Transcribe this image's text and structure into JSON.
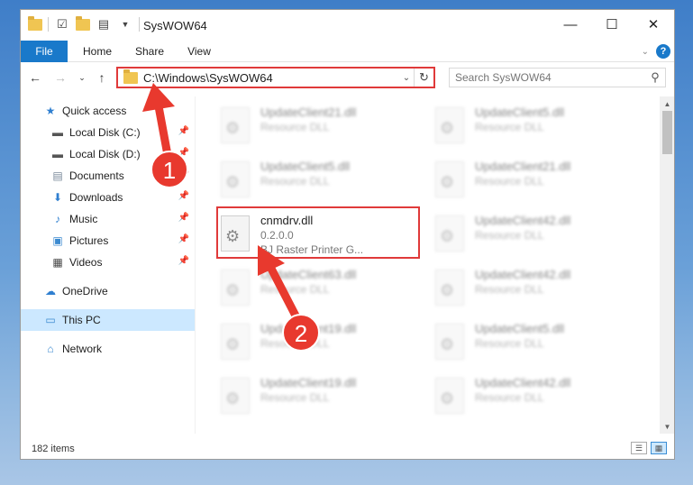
{
  "window": {
    "title": "SysWOW64",
    "min_glyph": "—",
    "max_glyph": "☐",
    "close_glyph": "✕"
  },
  "ribbon": {
    "tabs": [
      "File",
      "Home",
      "Share",
      "View"
    ]
  },
  "address": {
    "path": "C:\\Windows\\SysWOW64",
    "search_placeholder": "Search SysWOW64"
  },
  "sidebar": {
    "items": [
      {
        "label": "Quick access",
        "icon": "star-icon",
        "pinned": false
      },
      {
        "label": "Local Disk (C:)",
        "icon": "drive-icon",
        "pinned": true
      },
      {
        "label": "Local Disk (D:)",
        "icon": "drive-icon",
        "pinned": true
      },
      {
        "label": "Documents",
        "icon": "documents-icon",
        "pinned": true
      },
      {
        "label": "Downloads",
        "icon": "download-icon",
        "pinned": true
      },
      {
        "label": "Music",
        "icon": "music-icon",
        "pinned": true
      },
      {
        "label": "Pictures",
        "icon": "pictures-icon",
        "pinned": true
      },
      {
        "label": "Videos",
        "icon": "videos-icon",
        "pinned": true
      },
      {
        "label": "OneDrive",
        "icon": "cloud-icon",
        "pinned": false
      },
      {
        "label": "This PC",
        "icon": "computer-icon",
        "pinned": false,
        "selected": true
      },
      {
        "label": "Network",
        "icon": "network-icon",
        "pinned": false
      }
    ]
  },
  "files": [
    {
      "name": "UpdateClient21.dll",
      "sub": "Resource DLL",
      "blurred": true
    },
    {
      "name": "UpdateClient5.dll",
      "sub": "Resource DLL",
      "blurred": true
    },
    {
      "name": "UpdateClient5.dll",
      "sub": "Resource DLL",
      "blurred": true
    },
    {
      "name": "UpdateClient21.dll",
      "sub": "Resource DLL",
      "blurred": true
    },
    {
      "name": "cnmdrv.dll",
      "sub": "0.2.0.0",
      "sub2": "BJ Raster Printer G...",
      "blurred": false
    },
    {
      "name": "UpdateClient42.dll",
      "sub": "Resource DLL",
      "blurred": true
    },
    {
      "name": "UpdateClient63.dll",
      "sub": "Resource DLL",
      "blurred": true
    },
    {
      "name": "UpdateClient42.dll",
      "sub": "Resource DLL",
      "blurred": true
    },
    {
      "name": "UpdateClient19.dll",
      "sub": "Resource DLL",
      "blurred": true
    },
    {
      "name": "UpdateClient5.dll",
      "sub": "Resource DLL",
      "blurred": true
    },
    {
      "name": "UpdateClient19.dll",
      "sub": "Resource DLL",
      "blurred": true
    },
    {
      "name": "UpdateClient42.dll",
      "sub": "Resource DLL",
      "blurred": true
    }
  ],
  "status": {
    "item_count": "182 items"
  },
  "annotations": [
    {
      "number": "1"
    },
    {
      "number": "2"
    }
  ],
  "colors": {
    "accent": "#1979ca",
    "highlight_red": "#e03a3a",
    "annotation_red": "#e8392e",
    "selected_bg": "#cce8ff"
  }
}
